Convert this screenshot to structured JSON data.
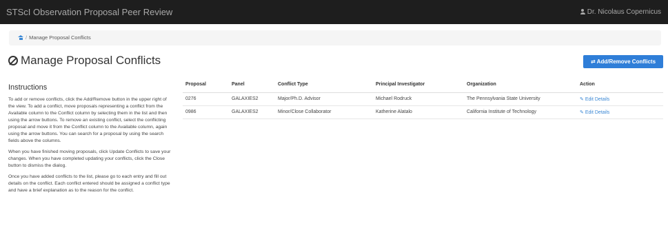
{
  "navbar": {
    "title": "STScI Observation Proposal Peer Review",
    "user_name": "Dr. Nicolaus Copernicus",
    "user_icon": "user-icon"
  },
  "breadcrumb": {
    "home_icon": "home-icon",
    "separator": "/",
    "current": "Manage Proposal Conflicts"
  },
  "page": {
    "title": "Manage Proposal Conflicts",
    "title_icon": "ban-icon"
  },
  "add_button": {
    "label": "Add/Remove Conflicts",
    "icon": "arrows-icon",
    "color": "#2f7ed8"
  },
  "instructions": {
    "heading": "Instructions",
    "paragraphs": [
      "To add or remove conflicts, click the Add/Remove button in the upper right of the view. To add a conflict, move proposals representing a conflict from the Available column to the Conflict column by selecting them in the list and then using the arrow buttons. To remove an existing conflict, select the conflicting proposal and move it from the Conflict column to the Available column, again using the arrow buttons. You can search for a proposal by using the search fields above the columns.",
      "When you have finished moving proposals, click Update Conflicts to save your changes. When you have completed updating your conflicts, click the Close button to dismiss the dialog.",
      "Once you have added conflicts to the list, please go to each entry and fill out details on the conflict. Each conflict entered should be assigned a conflict type and have a brief explanation as to the reason for the conflict."
    ]
  },
  "table": {
    "columns": [
      "Proposal",
      "Panel",
      "Conflict Type",
      "Principal Investigator",
      "Organization",
      "Action"
    ],
    "rows": [
      {
        "proposal": "0276",
        "panel": "GALAXIES2",
        "conflict_type": "Major/Ph.D. Advisor",
        "pi": "Michael Rodruck",
        "organization": "The Pennsylvania State University",
        "action": "Edit Details"
      },
      {
        "proposal": "0986",
        "panel": "GALAXIES2",
        "conflict_type": "Minor/Close Collaborator",
        "pi": "Katherine Alatalo",
        "organization": "California Institute of Technology",
        "action": "Edit Details"
      }
    ],
    "action_icon": "pencil-icon"
  },
  "colors": {
    "navbar_bg": "#1e1e1e",
    "link": "#3a87d4",
    "primary_button": "#2f7ed8"
  }
}
